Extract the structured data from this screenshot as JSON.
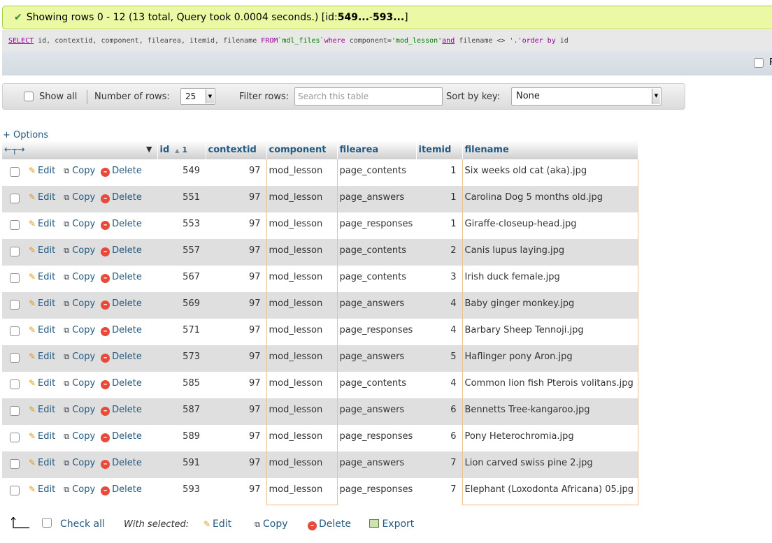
{
  "success": {
    "message": "Showing rows 0 - 12 (13 total, Query took 0.0004 seconds.) [id: ",
    "range_start": "549...",
    "range_sep": " - ",
    "range_end": "593...",
    "close": "]"
  },
  "sql": {
    "select": "SELECT",
    "cols": " id, contextid, component, filearea, itemid, filename ",
    "from": "FROM",
    "table": "`mdl_files`",
    "where": "where",
    "cond1": " component=",
    "val1": "'mod_lesson'",
    "and": "and",
    "cond2": " filename <> ",
    "val2": "'.'",
    "order": "order by",
    "ordcol": " id"
  },
  "strip": {
    "cutoff_text": "P"
  },
  "toolbar": {
    "show_all": "Show all",
    "number_of_rows": "Number of rows:",
    "rows_value": "25",
    "filter_rows": "Filter rows:",
    "search_placeholder": "Search this table",
    "sort_by_key": "Sort by key:",
    "sort_value": "None"
  },
  "options_link": "+ Options",
  "columns": {
    "id": "id",
    "sort_index": "1",
    "contextid": "contextid",
    "component": "component",
    "filearea": "filearea",
    "itemid": "itemid",
    "filename": "filename"
  },
  "actions": {
    "edit": "Edit",
    "copy": "Copy",
    "delete": "Delete"
  },
  "rows": [
    {
      "id": "549",
      "contextid": "97",
      "component": "mod_lesson",
      "filearea": "page_contents",
      "itemid": "1",
      "filename": "Six weeks old cat (aka).jpg"
    },
    {
      "id": "551",
      "contextid": "97",
      "component": "mod_lesson",
      "filearea": "page_answers",
      "itemid": "1",
      "filename": "Carolina Dog 5 months old.jpg"
    },
    {
      "id": "553",
      "contextid": "97",
      "component": "mod_lesson",
      "filearea": "page_responses",
      "itemid": "1",
      "filename": "Giraffe-closeup-head.jpg"
    },
    {
      "id": "557",
      "contextid": "97",
      "component": "mod_lesson",
      "filearea": "page_contents",
      "itemid": "2",
      "filename": "Canis lupus laying.jpg"
    },
    {
      "id": "567",
      "contextid": "97",
      "component": "mod_lesson",
      "filearea": "page_contents",
      "itemid": "3",
      "filename": "Irish duck female.jpg"
    },
    {
      "id": "569",
      "contextid": "97",
      "component": "mod_lesson",
      "filearea": "page_answers",
      "itemid": "4",
      "filename": "Baby ginger monkey.jpg"
    },
    {
      "id": "571",
      "contextid": "97",
      "component": "mod_lesson",
      "filearea": "page_responses",
      "itemid": "4",
      "filename": "Barbary Sheep Tennoji.jpg"
    },
    {
      "id": "573",
      "contextid": "97",
      "component": "mod_lesson",
      "filearea": "page_answers",
      "itemid": "5",
      "filename": "Haflinger pony Aron.jpg"
    },
    {
      "id": "585",
      "contextid": "97",
      "component": "mod_lesson",
      "filearea": "page_contents",
      "itemid": "4",
      "filename": "Common lion fish Pterois volitans.jpg"
    },
    {
      "id": "587",
      "contextid": "97",
      "component": "mod_lesson",
      "filearea": "page_answers",
      "itemid": "6",
      "filename": "Bennetts Tree-kangaroo.jpg"
    },
    {
      "id": "589",
      "contextid": "97",
      "component": "mod_lesson",
      "filearea": "page_responses",
      "itemid": "6",
      "filename": "Pony Heterochromia.jpg"
    },
    {
      "id": "591",
      "contextid": "97",
      "component": "mod_lesson",
      "filearea": "page_answers",
      "itemid": "7",
      "filename": "Lion carved swiss pine 2.jpg"
    },
    {
      "id": "593",
      "contextid": "97",
      "component": "mod_lesson",
      "filearea": "page_responses",
      "itemid": "7",
      "filename": "Elephant (Loxodonta Africana) 05.jpg"
    }
  ],
  "bottom": {
    "check_all": "Check all",
    "with_selected": "With selected:",
    "edit": "Edit",
    "copy": "Copy",
    "delete": "Delete",
    "export": "Export"
  },
  "colors": {
    "success_bg": "#ebf8a4",
    "link": "#235a81",
    "row_alt": "#dfdfdf",
    "highlight_border": "#f0c090"
  }
}
